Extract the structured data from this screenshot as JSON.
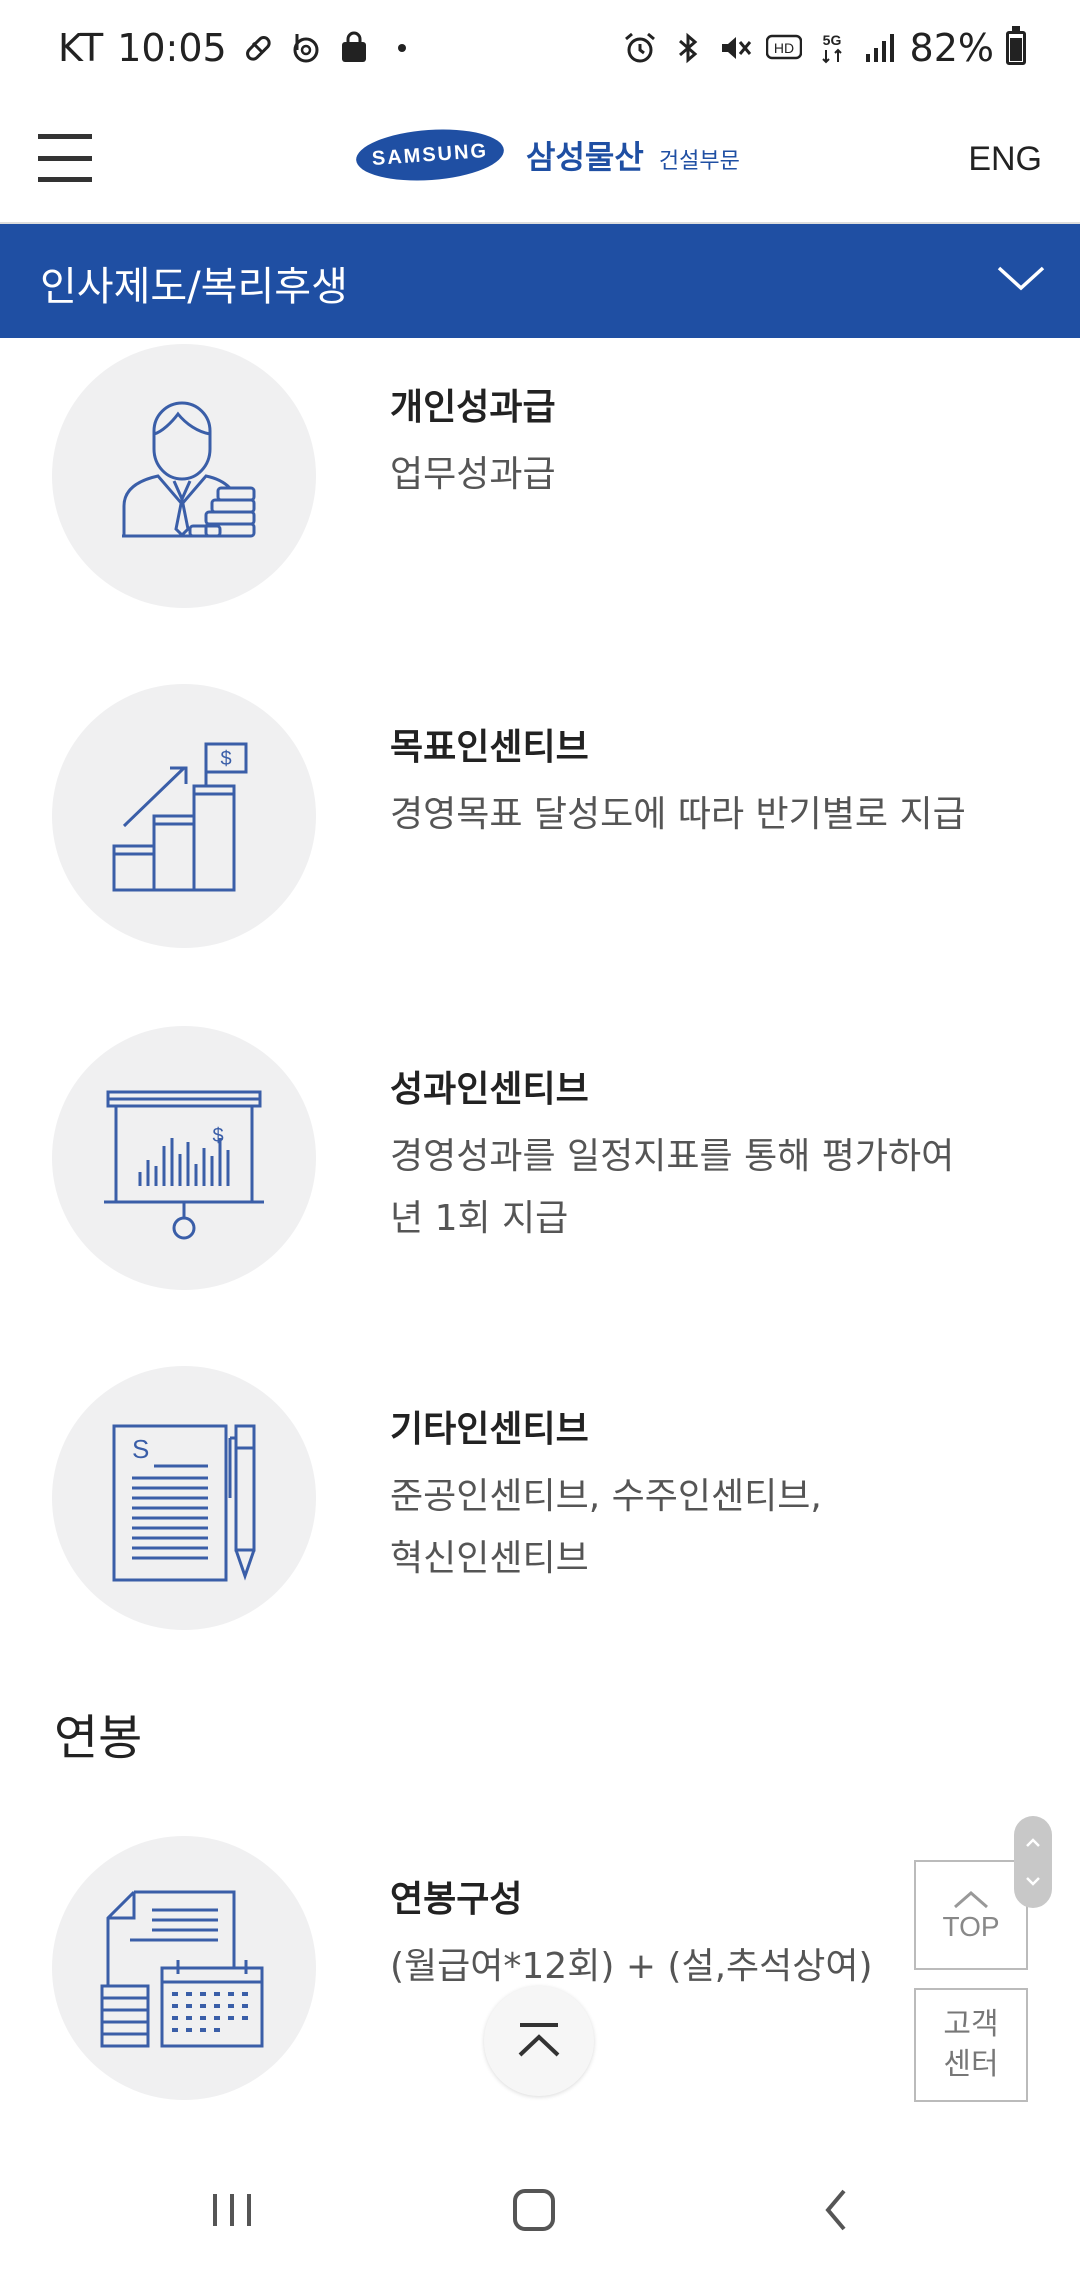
{
  "status_bar": {
    "carrier": "KT",
    "time": "10:05",
    "battery": "82%",
    "battery_level": 0.82,
    "left_icons": [
      "pill-icon",
      "b-app-icon",
      "shopping-bag-icon",
      "dot-icon"
    ],
    "right_icons": [
      "alarm-icon",
      "bluetooth-icon",
      "mute-icon",
      "hd-icon",
      "5g-icon",
      "signal-icon",
      "battery-icon"
    ]
  },
  "header": {
    "logo_brand": "SAMSUNG",
    "logo_company": "삼성물산",
    "logo_division": "건설부문",
    "lang_label": "ENG"
  },
  "category_bar": {
    "title": "인사제도/복리후생"
  },
  "items": [
    {
      "title": "개인성과급",
      "desc": "업무성과급",
      "icon": "employee-coins-icon"
    },
    {
      "title": "목표인센티브",
      "desc": "경영목표 달성도에 따라 반기별로 지급",
      "icon": "growth-stairs-icon"
    },
    {
      "title": "성과인센티브",
      "desc_line1": "경영성과를 일정지표를 통해 평가하여",
      "desc_line2": "년 1회 지급",
      "icon": "presentation-chart-icon"
    },
    {
      "title": "기타인센티브",
      "desc_line1": "준공인센티브, 수주인센티브,",
      "desc_line2": "혁신인센티브",
      "icon": "document-pen-icon"
    }
  ],
  "section": {
    "heading": "연봉"
  },
  "salary_item": {
    "title": "연봉구성",
    "desc": "(월급여*12회) + (설,추석상여)",
    "icon": "calendar-documents-icon"
  },
  "floating": {
    "top_label": "TOP",
    "cs_line1": "고객",
    "cs_line2": "센터"
  },
  "colors": {
    "brand_blue": "#1f4fa3",
    "icon_blue": "#3a5ea8",
    "circle_bg": "#f0f0f1"
  }
}
